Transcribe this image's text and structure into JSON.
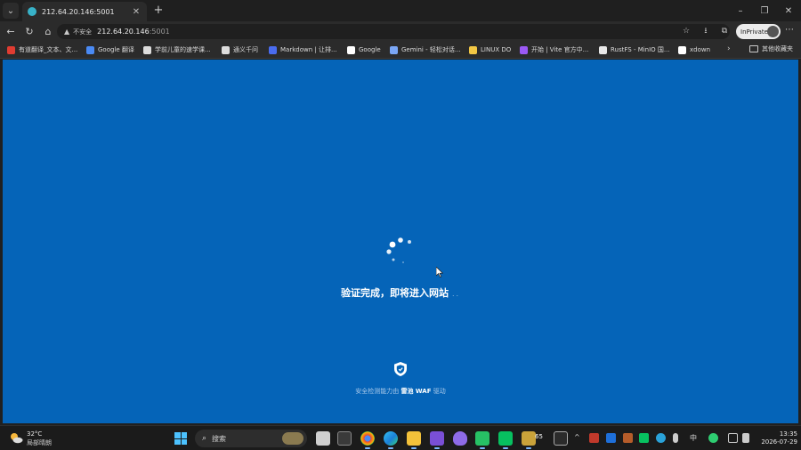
{
  "browser": {
    "tab": {
      "title": "212.64.20.146:5001",
      "close": "✕"
    },
    "new_tab": "+",
    "tab_menu": "⌄",
    "window_controls": {
      "minimize": "–",
      "maximize": "❐",
      "close": "✕"
    },
    "nav": {
      "back": "←",
      "reload": "↻",
      "home": "⌂"
    },
    "address": {
      "warning_icon": "▲",
      "security_label": "不安全",
      "host": "212.64.20.146",
      "port": ":5001"
    },
    "toolbar_right": {
      "favorite": "☆",
      "download": "⭳",
      "split": "⧉"
    },
    "inprivate_label": "InPrivate",
    "more": "⋯"
  },
  "bookmarks": [
    {
      "label": "有道翻译_文本、文...",
      "color": "#e03c31"
    },
    {
      "label": "Google 翻译",
      "color": "#4a8af4"
    },
    {
      "label": "学前儿童的速学课...",
      "color": "#dddddd"
    },
    {
      "label": "通义千问",
      "color": "#dddddd"
    },
    {
      "label": "Markdown | 让排...",
      "color": "#4a6cf0"
    },
    {
      "label": "Google",
      "color": "#ffffff"
    },
    {
      "label": "Gemini - 轻松对话...",
      "color": "#7aa6f5"
    },
    {
      "label": "LINUX DO",
      "color": "#f2c744"
    },
    {
      "label": "开始 | Vite 官方中...",
      "color": "#9b59f5"
    },
    {
      "label": "RustFS - MinIO 国...",
      "color": "#e8e8e8"
    },
    {
      "label": "xdown",
      "color": "#ffffff"
    }
  ],
  "bookmarks_more": "›",
  "bookmarks_folder": "其他收藏夹",
  "page": {
    "verify_message": "验证完成，即将进入网站",
    "verify_dots": "..",
    "powered_prefix": "安全检测能力由",
    "powered_brand": "雷池 WAF",
    "powered_suffix": "驱动"
  },
  "taskbar": {
    "weather_temp": "32°C",
    "weather_desc": "局部晴朗",
    "search_label": "搜索",
    "search_icon": "⌕",
    "tray_chevron": "^",
    "ime": "中",
    "badge": "65",
    "time": "13:35",
    "date": "2026-07-29"
  },
  "colors": {
    "page_bg": "#0564b8",
    "brand_text": "#ffffff"
  }
}
